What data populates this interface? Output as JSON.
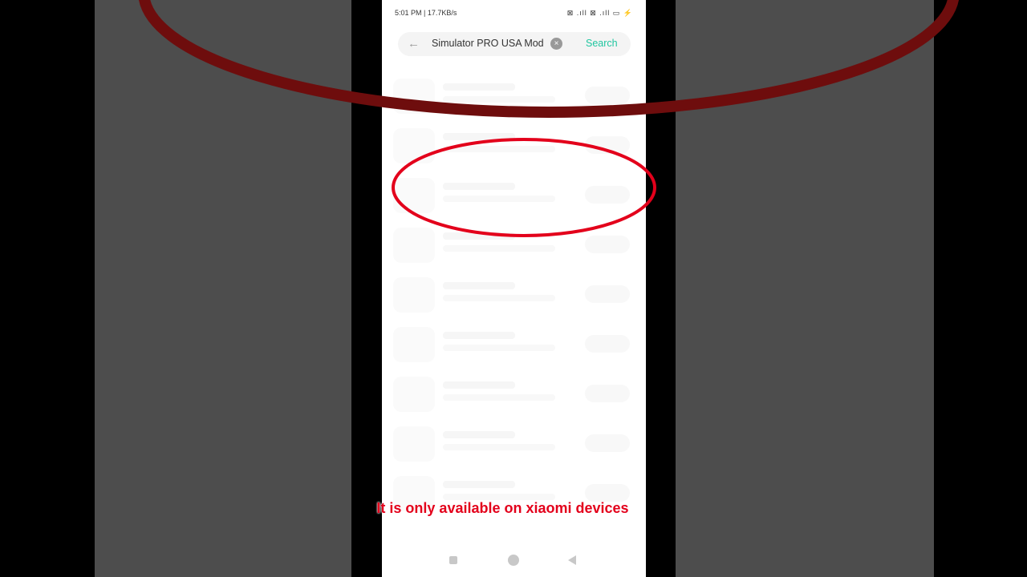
{
  "status_bar": {
    "time_info": "5:01 PM | 17.7KB/s",
    "indicators": "⊠ .ıll ⊠ .ıll ▭ ⚡"
  },
  "search": {
    "query": "Simulator PRO USA Mod",
    "back_icon": "arrow-left-icon",
    "clear_icon": "clear-circle-icon",
    "button_label": "Search"
  },
  "results": {
    "loading_rows": 9
  },
  "nav_bar": {
    "items": [
      "recent-apps",
      "home",
      "back"
    ]
  },
  "caption": "It is only available on xiaomi devices",
  "colors": {
    "accent": "#20c6a0",
    "annotation_red": "#e3001b",
    "side_panel": "#4d4d4d",
    "skeleton": "#f6f6f6"
  }
}
